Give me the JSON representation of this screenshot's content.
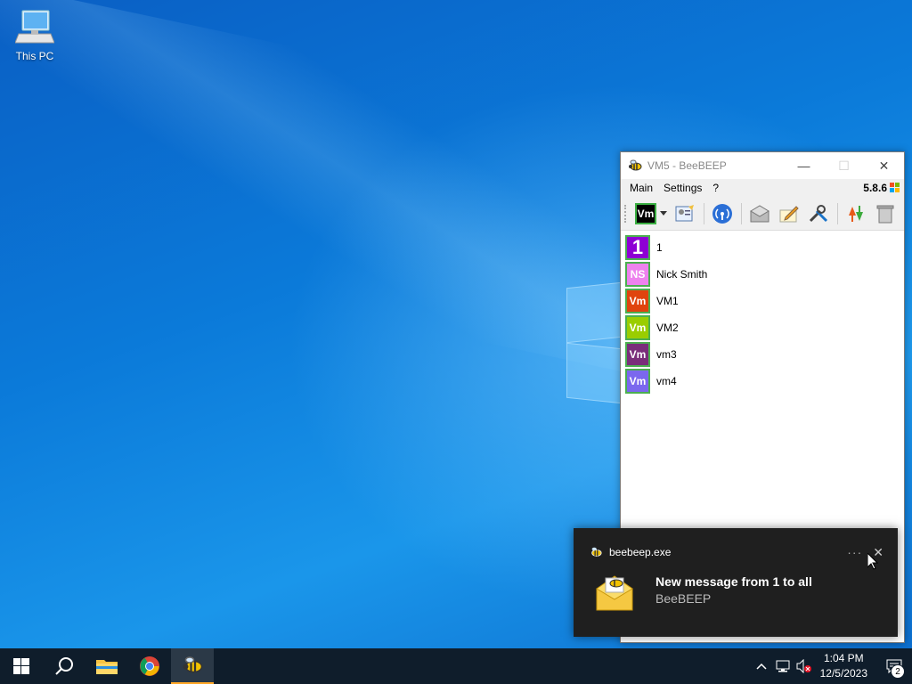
{
  "desktop": {
    "icons": [
      {
        "label": "This PC",
        "icon": "computer-icon"
      }
    ]
  },
  "window": {
    "title": "VM5 - BeeBEEP",
    "menu": [
      "Main",
      "Settings",
      "?"
    ],
    "version": "5.8.6",
    "status_badge": "Vm",
    "users": [
      {
        "avatar": "1",
        "name": "1",
        "color": "#8e00d4"
      },
      {
        "avatar": "NS",
        "name": "Nick Smith",
        "color": "#ee82ee"
      },
      {
        "avatar": "Vm",
        "name": "VM1",
        "color": "#e0440e"
      },
      {
        "avatar": "Vm",
        "name": "VM2",
        "color": "#9acd00"
      },
      {
        "avatar": "Vm",
        "name": "vm3",
        "color": "#7a2e7a"
      },
      {
        "avatar": "Vm",
        "name": "vm4",
        "color": "#7b68ee"
      }
    ]
  },
  "toast": {
    "source": "beebeep.exe",
    "more": "···",
    "close": "✕",
    "message": "New message from 1 to all",
    "app": "BeeBEEP"
  },
  "taskbar": {
    "time": "1:04 PM",
    "date": "12/5/2023",
    "notification_count": "2"
  }
}
